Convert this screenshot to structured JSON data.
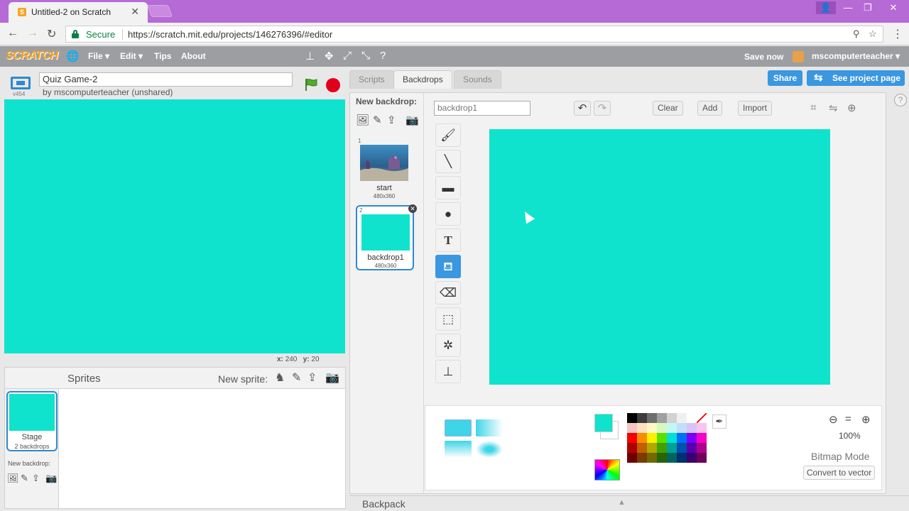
{
  "browser": {
    "tab_title": "Untitled-2 on Scratch",
    "tab_close": "✕",
    "secure_label": "Secure",
    "url": "https://scratch.mit.edu/projects/146276396/#editor"
  },
  "menubar": {
    "logo": "SCRATCH",
    "file": "File ▾",
    "edit": "Edit ▾",
    "tips": "Tips",
    "about": "About",
    "save_now": "Save now",
    "username": "mscomputerteacher ▾"
  },
  "stage": {
    "version": "v454",
    "project_title": "Quiz Game-2",
    "byline": "by mscomputerteacher (unshared)",
    "x_label": "x:",
    "x_value": "240",
    "y_label": "y:",
    "y_value": "20",
    "backdrop_color": "#0fe3cd"
  },
  "sprites": {
    "label": "Sprites",
    "new_sprite": "New sprite:",
    "stage_label": "Stage",
    "stage_sub": "2 backdrops",
    "new_backdrop": "New backdrop:"
  },
  "tabs": {
    "scripts": "Scripts",
    "backdrops": "Backdrops",
    "sounds": "Sounds",
    "share": "Share",
    "see_project": "See project page",
    "help": "?"
  },
  "editor": {
    "new_backdrop": "New backdrop:",
    "backdrops": [
      {
        "num": "1",
        "name": "start",
        "size": "480x360"
      },
      {
        "num": "2",
        "name": "backdrop1",
        "size": "480x360"
      }
    ],
    "costume_name": "backdrop1",
    "clear": "Clear",
    "add": "Add",
    "import": "Import",
    "zoom": "100%",
    "mode": "Bitmap Mode",
    "convert": "Convert to vector"
  },
  "colors": {
    "accent": "#3a97e0",
    "canvas": "#0fe3cd",
    "palette": [
      "#000000",
      "#3c3c3c",
      "#6e6e6e",
      "#a0a0a0",
      "#d2d2d2",
      "#f0f0f0",
      "#ffffff",
      "none",
      "#f7c3c3",
      "#fbe0c3",
      "#fcf7c3",
      "#d8f7c3",
      "#c3f7f3",
      "#c3dff7",
      "#d8c3f7",
      "#f7c3ef",
      "#f70000",
      "#fb8c00",
      "#fcf000",
      "#5ae000",
      "#00e0d4",
      "#0070f7",
      "#7a00f7",
      "#f700c8",
      "#b00000",
      "#c06000",
      "#b0a800",
      "#40a000",
      "#00a09a",
      "#0050b0",
      "#5800b0",
      "#b0008e",
      "#700000",
      "#7a3c00",
      "#706a00",
      "#286400",
      "#006460",
      "#003070",
      "#380070",
      "#70005a"
    ]
  },
  "backpack": {
    "label": "Backpack",
    "arrow": "▲"
  }
}
